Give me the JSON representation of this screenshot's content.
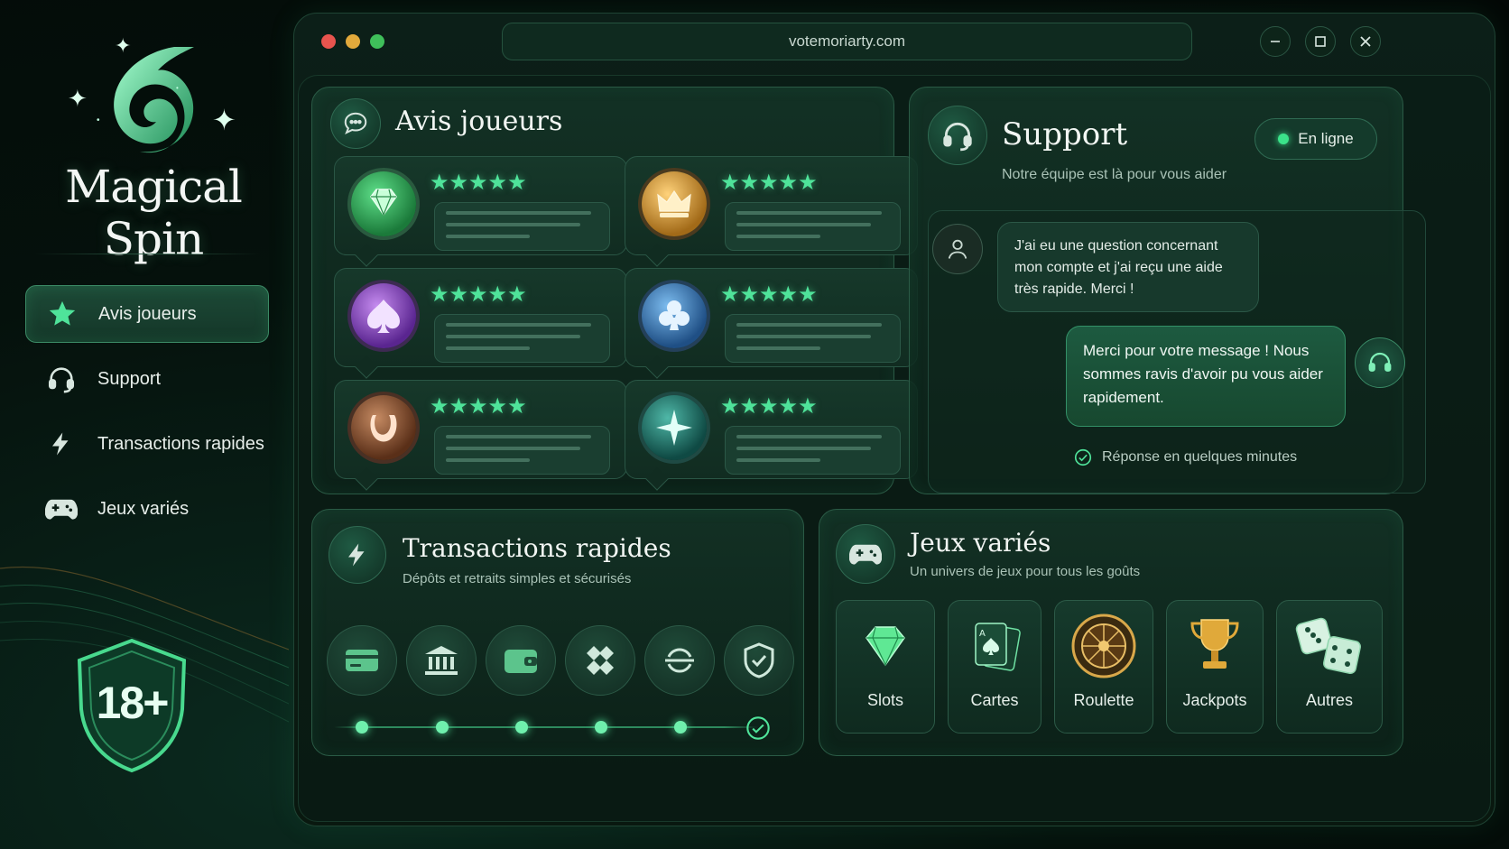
{
  "brand": {
    "name": "Magical Spin",
    "age_badge": "18+"
  },
  "sidebar": {
    "items": [
      {
        "label": "Avis joueurs",
        "icon": "star-icon",
        "active": true
      },
      {
        "label": "Support",
        "icon": "headset-icon",
        "active": false
      },
      {
        "label": "Transactions rapides",
        "icon": "lightning-icon",
        "active": false
      },
      {
        "label": "Jeux variés",
        "icon": "gamepad-icon",
        "active": false
      }
    ]
  },
  "window": {
    "url": "votemoriarty.com",
    "controls": [
      "minimize-icon",
      "maximize-icon",
      "close-icon"
    ]
  },
  "reviews": {
    "title": "Avis joueurs",
    "cards": [
      {
        "badge": "diamond-icon",
        "stars": "★★★★★",
        "rating": 5,
        "color": "#2f9e52"
      },
      {
        "badge": "crown-icon",
        "stars": "★★★★★",
        "rating": 5,
        "color": "#c9902c"
      },
      {
        "badge": "spade-icon",
        "stars": "★★★★★",
        "rating": 5,
        "color": "#7d3fb0"
      },
      {
        "badge": "club-icon",
        "stars": "★★★★★",
        "rating": 5,
        "color": "#2b6fa8"
      },
      {
        "badge": "horseshoe-icon",
        "stars": "★★★★★",
        "rating": 5,
        "color": "#8a4f2e"
      },
      {
        "badge": "compass-star-icon",
        "stars": "★★★★★",
        "rating": 5,
        "color": "#1d6a62"
      }
    ]
  },
  "support": {
    "title": "Support",
    "subtitle": "Notre équipe est là pour vous aider",
    "status": "En ligne",
    "message_in": "J'ai eu une question concernant mon compte et j'ai reçu une aide très rapide. Merci !",
    "message_out": "Merci pour votre message ! Nous sommes ravis d'avoir pu vous aider rapidement.",
    "response_time": "Réponse en quelques minutes"
  },
  "transactions": {
    "title": "Transactions rapides",
    "subtitle": "Dépôts et retraits simples et sécurisés",
    "methods": [
      "card-icon",
      "bank-icon",
      "wallet-icon",
      "crypto-icon",
      "transfer-icon",
      "shield-check-icon"
    ],
    "check_icon": "check-circle-icon"
  },
  "games": {
    "title": "Jeux variés",
    "subtitle": "Un univers de jeux pour tous les goûts",
    "items": [
      {
        "label": "Slots",
        "icon": "gem-icon"
      },
      {
        "label": "Cartes",
        "icon": "cards-icon"
      },
      {
        "label": "Roulette",
        "icon": "roulette-icon"
      },
      {
        "label": "Jackpots",
        "icon": "trophy-icon"
      },
      {
        "label": "Autres",
        "icon": "dice-icon"
      }
    ]
  },
  "colors": {
    "accent": "#4fe39a",
    "panel_border": "#2a5a45",
    "background": "#05110c"
  }
}
